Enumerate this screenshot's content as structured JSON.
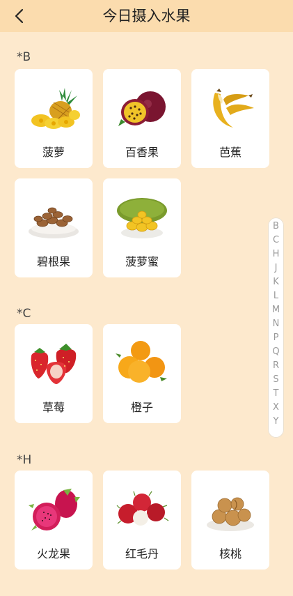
{
  "header": {
    "title": "今日摄入水果",
    "back_icon": "chevron-left-icon"
  },
  "sections": [
    {
      "title": "*B",
      "items": [
        {
          "label": "菠萝",
          "icon": "pineapple-icon"
        },
        {
          "label": "百香果",
          "icon": "passion-fruit-icon"
        },
        {
          "label": "芭蕉",
          "icon": "banana-icon"
        },
        {
          "label": "碧根果",
          "icon": "pecan-icon"
        },
        {
          "label": "菠萝蜜",
          "icon": "jackfruit-icon"
        }
      ]
    },
    {
      "title": "*C",
      "items": [
        {
          "label": "草莓",
          "icon": "strawberry-icon"
        },
        {
          "label": "橙子",
          "icon": "orange-icon"
        }
      ]
    },
    {
      "title": "*H",
      "items": [
        {
          "label": "火龙果",
          "icon": "dragon-fruit-icon"
        },
        {
          "label": "红毛丹",
          "icon": "rambutan-icon"
        },
        {
          "label": "核桃",
          "icon": "walnut-icon"
        }
      ]
    }
  ],
  "index_bar": {
    "letters": [
      "B",
      "C",
      "H",
      "J",
      "K",
      "L",
      "M",
      "N",
      "P",
      "Q",
      "R",
      "S",
      "T",
      "X",
      "Y"
    ]
  },
  "colors": {
    "background": "#fde9cd",
    "header": "#fbdcae",
    "card": "#ffffff"
  }
}
